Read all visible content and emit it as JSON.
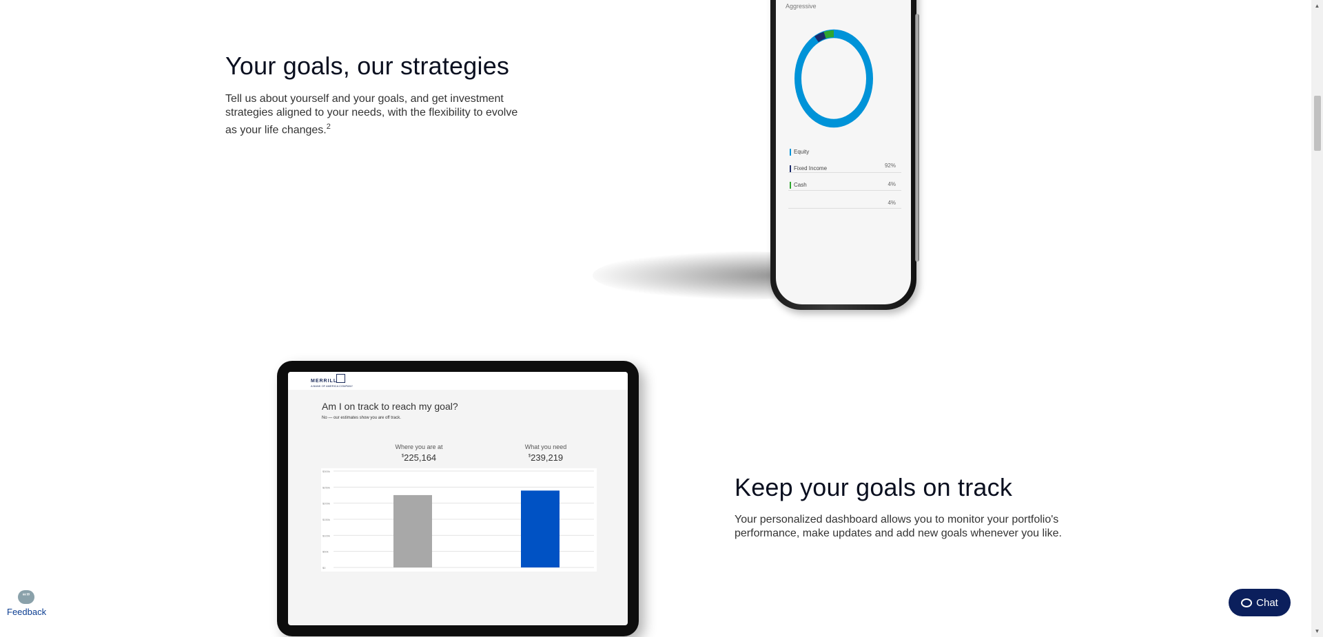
{
  "section1": {
    "heading": "Your goals, our strategies",
    "body": "Tell us about yourself and your goals, and get investment strategies aligned to your needs, with the flexibility to evolve as your life changes.",
    "footnote": "2"
  },
  "phone": {
    "risk_label": "Aggressive",
    "allocation": [
      {
        "label": "Equity",
        "value": "92%",
        "color": "#0093d8"
      },
      {
        "label": "Fixed Income",
        "value": "4%",
        "color": "#1b2b6b"
      },
      {
        "label": "Cash",
        "value": "4%",
        "color": "#2fa52f"
      }
    ]
  },
  "tablet": {
    "brand": "MERRILL",
    "brand_sub": "A BANK OF AMERICA COMPANY",
    "question": "Am I on track to reach my goal?",
    "answer": "No — our estimates show you are off track.",
    "where_label": "Where you are at",
    "where_value": "225,164",
    "need_label": "What you need",
    "need_value": "239,219",
    "currency": "$"
  },
  "chart_data": {
    "type": "bar",
    "categories": [
      "Where you are at",
      "What you need"
    ],
    "values": [
      225164,
      239219
    ],
    "colors": [
      "#a8a8a8",
      "#0052c4"
    ],
    "yticks": [
      "$0",
      "$50k",
      "$100k",
      "$150k",
      "$200k",
      "$250k",
      "$300k"
    ],
    "ylim": [
      0,
      300000
    ],
    "grid": true
  },
  "section2": {
    "heading": "Keep your goals on track",
    "body": "Your personalized dashboard allows you to monitor your portfolio's performance, make updates and add new goals whenever you like."
  },
  "feedback": {
    "label": "Feedback",
    "icon_glyph": "“”",
    "icon": "feedback-quote-icon"
  },
  "chat": {
    "label": "Chat",
    "icon": "chat-bubble-icon"
  },
  "scrollbar": {
    "up_glyph": "▲",
    "down_glyph": "▼"
  }
}
